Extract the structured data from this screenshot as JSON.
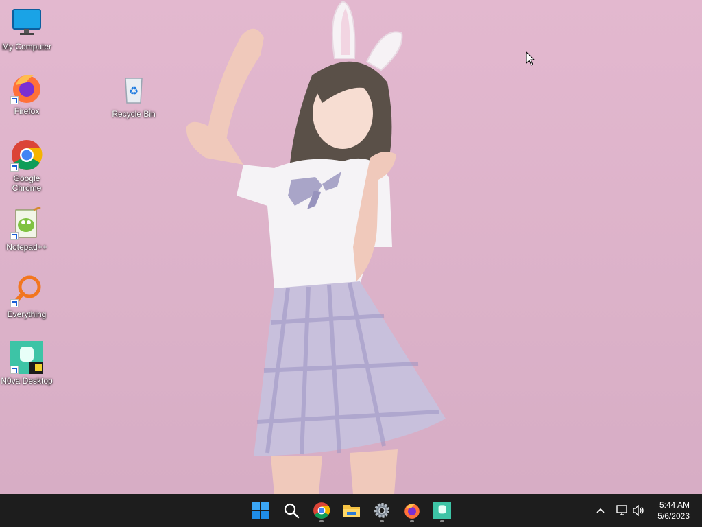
{
  "desktop": {
    "icons": [
      {
        "label": "My Computer",
        "icon": "monitor-icon"
      },
      {
        "label": "Firefox",
        "icon": "firefox-icon"
      },
      {
        "label": "Recycle Bin",
        "icon": "recycle-bin-icon"
      },
      {
        "label": "Google Chrome",
        "icon": "chrome-icon"
      },
      {
        "label": "Notepad++",
        "icon": "notepadpp-icon"
      },
      {
        "label": "Everything",
        "icon": "everything-search-icon"
      },
      {
        "label": "N0va Desktop",
        "icon": "n0va-desktop-icon"
      }
    ],
    "wallpaper_colors": {
      "background": "#dfb4cb",
      "shirt": "#f5f3f6",
      "skirt": "#b7aed0",
      "hair": "#5a5048"
    }
  },
  "taskbar": {
    "apps": [
      {
        "name": "Start",
        "icon": "windows-start-icon"
      },
      {
        "name": "Search",
        "icon": "search-icon"
      },
      {
        "name": "Google Chrome",
        "icon": "chrome-icon"
      },
      {
        "name": "File Explorer",
        "icon": "folder-icon"
      },
      {
        "name": "Settings",
        "icon": "settings-gear-icon"
      },
      {
        "name": "Firefox",
        "icon": "firefox-icon"
      },
      {
        "name": "N0va Desktop",
        "icon": "n0va-desktop-icon"
      }
    ],
    "tray": {
      "overflow_icon": "chevron-up-icon",
      "network_icon": "network-icon",
      "volume_icon": "volume-icon",
      "time": "5:44 AM",
      "date": "5/6/2023"
    },
    "background": "#1d1d1d"
  }
}
